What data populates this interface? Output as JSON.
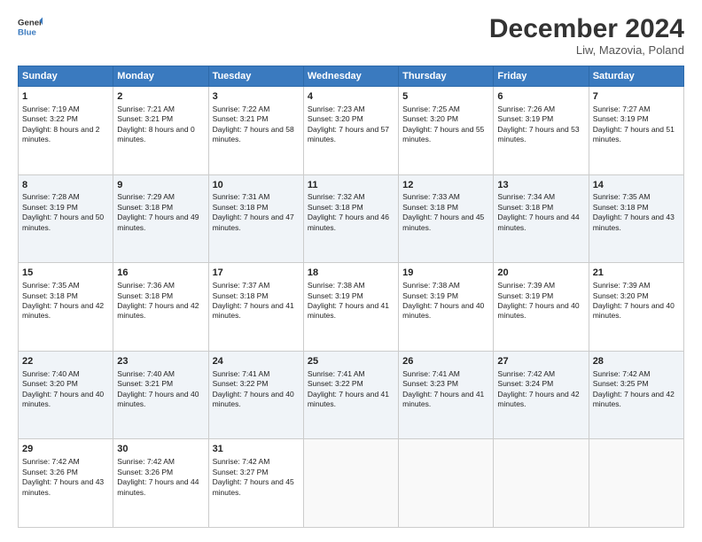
{
  "header": {
    "logo_line1": "General",
    "logo_line2": "Blue",
    "month": "December 2024",
    "location": "Liw, Mazovia, Poland"
  },
  "weekdays": [
    "Sunday",
    "Monday",
    "Tuesday",
    "Wednesday",
    "Thursday",
    "Friday",
    "Saturday"
  ],
  "weeks": [
    [
      {
        "day": 1,
        "sunrise": "7:19 AM",
        "sunset": "3:22 PM",
        "daylight": "8 hours and 2 minutes."
      },
      {
        "day": 2,
        "sunrise": "7:21 AM",
        "sunset": "3:21 PM",
        "daylight": "8 hours and 0 minutes."
      },
      {
        "day": 3,
        "sunrise": "7:22 AM",
        "sunset": "3:21 PM",
        "daylight": "7 hours and 58 minutes."
      },
      {
        "day": 4,
        "sunrise": "7:23 AM",
        "sunset": "3:20 PM",
        "daylight": "7 hours and 57 minutes."
      },
      {
        "day": 5,
        "sunrise": "7:25 AM",
        "sunset": "3:20 PM",
        "daylight": "7 hours and 55 minutes."
      },
      {
        "day": 6,
        "sunrise": "7:26 AM",
        "sunset": "3:19 PM",
        "daylight": "7 hours and 53 minutes."
      },
      {
        "day": 7,
        "sunrise": "7:27 AM",
        "sunset": "3:19 PM",
        "daylight": "7 hours and 51 minutes."
      }
    ],
    [
      {
        "day": 8,
        "sunrise": "7:28 AM",
        "sunset": "3:19 PM",
        "daylight": "7 hours and 50 minutes."
      },
      {
        "day": 9,
        "sunrise": "7:29 AM",
        "sunset": "3:18 PM",
        "daylight": "7 hours and 49 minutes."
      },
      {
        "day": 10,
        "sunrise": "7:31 AM",
        "sunset": "3:18 PM",
        "daylight": "7 hours and 47 minutes."
      },
      {
        "day": 11,
        "sunrise": "7:32 AM",
        "sunset": "3:18 PM",
        "daylight": "7 hours and 46 minutes."
      },
      {
        "day": 12,
        "sunrise": "7:33 AM",
        "sunset": "3:18 PM",
        "daylight": "7 hours and 45 minutes."
      },
      {
        "day": 13,
        "sunrise": "7:34 AM",
        "sunset": "3:18 PM",
        "daylight": "7 hours and 44 minutes."
      },
      {
        "day": 14,
        "sunrise": "7:35 AM",
        "sunset": "3:18 PM",
        "daylight": "7 hours and 43 minutes."
      }
    ],
    [
      {
        "day": 15,
        "sunrise": "7:35 AM",
        "sunset": "3:18 PM",
        "daylight": "7 hours and 42 minutes."
      },
      {
        "day": 16,
        "sunrise": "7:36 AM",
        "sunset": "3:18 PM",
        "daylight": "7 hours and 42 minutes."
      },
      {
        "day": 17,
        "sunrise": "7:37 AM",
        "sunset": "3:18 PM",
        "daylight": "7 hours and 41 minutes."
      },
      {
        "day": 18,
        "sunrise": "7:38 AM",
        "sunset": "3:19 PM",
        "daylight": "7 hours and 41 minutes."
      },
      {
        "day": 19,
        "sunrise": "7:38 AM",
        "sunset": "3:19 PM",
        "daylight": "7 hours and 40 minutes."
      },
      {
        "day": 20,
        "sunrise": "7:39 AM",
        "sunset": "3:19 PM",
        "daylight": "7 hours and 40 minutes."
      },
      {
        "day": 21,
        "sunrise": "7:39 AM",
        "sunset": "3:20 PM",
        "daylight": "7 hours and 40 minutes."
      }
    ],
    [
      {
        "day": 22,
        "sunrise": "7:40 AM",
        "sunset": "3:20 PM",
        "daylight": "7 hours and 40 minutes."
      },
      {
        "day": 23,
        "sunrise": "7:40 AM",
        "sunset": "3:21 PM",
        "daylight": "7 hours and 40 minutes."
      },
      {
        "day": 24,
        "sunrise": "7:41 AM",
        "sunset": "3:22 PM",
        "daylight": "7 hours and 40 minutes."
      },
      {
        "day": 25,
        "sunrise": "7:41 AM",
        "sunset": "3:22 PM",
        "daylight": "7 hours and 41 minutes."
      },
      {
        "day": 26,
        "sunrise": "7:41 AM",
        "sunset": "3:23 PM",
        "daylight": "7 hours and 41 minutes."
      },
      {
        "day": 27,
        "sunrise": "7:42 AM",
        "sunset": "3:24 PM",
        "daylight": "7 hours and 42 minutes."
      },
      {
        "day": 28,
        "sunrise": "7:42 AM",
        "sunset": "3:25 PM",
        "daylight": "7 hours and 42 minutes."
      }
    ],
    [
      {
        "day": 29,
        "sunrise": "7:42 AM",
        "sunset": "3:26 PM",
        "daylight": "7 hours and 43 minutes."
      },
      {
        "day": 30,
        "sunrise": "7:42 AM",
        "sunset": "3:26 PM",
        "daylight": "7 hours and 44 minutes."
      },
      {
        "day": 31,
        "sunrise": "7:42 AM",
        "sunset": "3:27 PM",
        "daylight": "7 hours and 45 minutes."
      },
      null,
      null,
      null,
      null
    ]
  ]
}
